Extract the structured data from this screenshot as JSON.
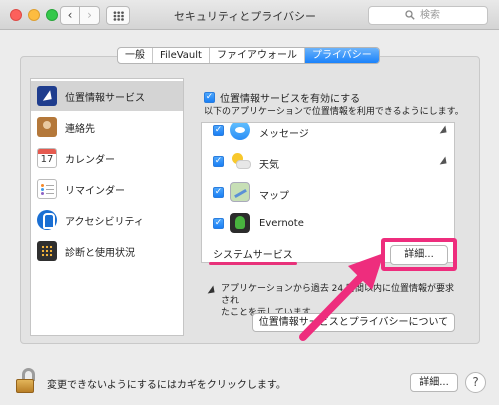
{
  "window": {
    "title": "セキュリティとプライバシー"
  },
  "toolbar": {
    "back_glyph": "‹",
    "forward_glyph": "›",
    "search_placeholder": "検索"
  },
  "tabs": [
    {
      "label": "一般",
      "active": false
    },
    {
      "label": "FileVault",
      "active": false
    },
    {
      "label": "ファイアウォール",
      "active": false
    },
    {
      "label": "プライバシー",
      "active": true
    }
  ],
  "sidebar": {
    "items": [
      {
        "label": "位置情報サービス",
        "icon": "location-icon",
        "selected": true
      },
      {
        "label": "連絡先",
        "icon": "contacts-icon",
        "selected": false
      },
      {
        "label": "カレンダー",
        "icon": "calendar-icon",
        "selected": false,
        "icon_text": "17"
      },
      {
        "label": "リマインダー",
        "icon": "reminders-icon",
        "selected": false
      },
      {
        "label": "アクセシビリティ",
        "icon": "accessibility-icon",
        "selected": false
      },
      {
        "label": "診断と使用状況",
        "icon": "diagnostics-icon",
        "selected": false
      }
    ]
  },
  "location": {
    "enable_label": "位置情報サービスを有効にする",
    "enabled": true,
    "description": "以下のアプリケーションで位置情報を利用できるようにします。",
    "apps": [
      {
        "name": "メッセージ",
        "checked": true,
        "icon": "messages-icon",
        "location_arrow": true
      },
      {
        "name": "天気",
        "checked": true,
        "icon": "weather-icon",
        "location_arrow": true
      },
      {
        "name": "マップ",
        "checked": true,
        "icon": "maps-icon",
        "location_arrow": false
      },
      {
        "name": "Evernote",
        "checked": true,
        "icon": "evernote-icon",
        "location_arrow": false
      }
    ],
    "system_services_label": "システムサービス",
    "details_button": "詳細...",
    "note_line1": "アプリケーションから過去 24 時間以内に位置情報が要求され",
    "note_line2": "たことを示しています。",
    "about_button": "位置情報サービスとプライバシーについて"
  },
  "footer": {
    "lock_text": "変更できないようにするにはカギをクリックします。",
    "details_button": "詳細...",
    "help_label": "?"
  },
  "colors": {
    "accent": "#1a82fb",
    "highlight": "#ee2d7d"
  }
}
